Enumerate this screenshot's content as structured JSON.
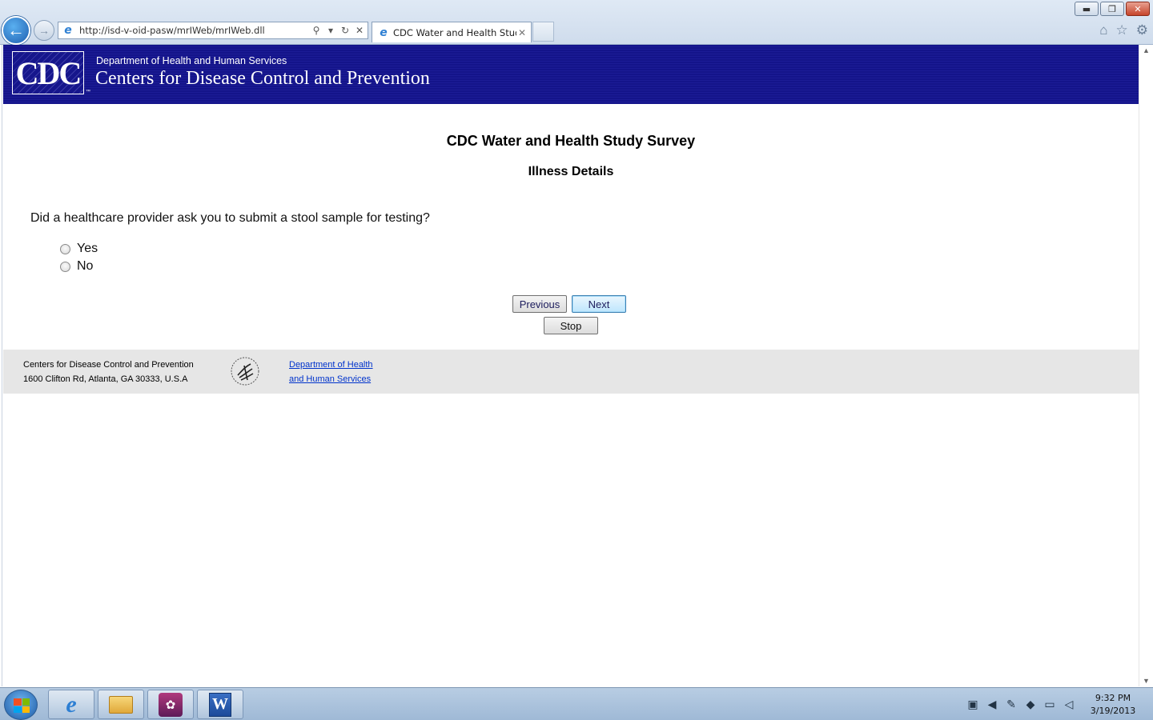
{
  "browser": {
    "url": "http://isd-v-oid-pasw/mrIWeb/mrIWeb.dll",
    "tab_title": "CDC Water and Health Study",
    "tab_close": "✕",
    "window_controls": {
      "minimize": "▬",
      "restore": "❐",
      "close": "✕"
    },
    "icons": [
      "back-icon",
      "forward-icon",
      "ie-icon",
      "search-icon",
      "refresh-icon",
      "stop-load-icon",
      "home-icon",
      "favorites-star-icon",
      "tools-gear-icon"
    ]
  },
  "banner": {
    "logo_text": "CDC",
    "logo_tm": "™",
    "department": "Department of Health and Human Services",
    "agency": "Centers for Disease Control and Prevention",
    "background_color": "#14148a"
  },
  "survey": {
    "title": "CDC Water and Health Study Survey",
    "section": "Illness Details",
    "question": "Did a healthcare provider ask you to submit a stool sample for testing?",
    "options": [
      {
        "label": "Yes",
        "selected": false
      },
      {
        "label": "No",
        "selected": false
      }
    ],
    "buttons": {
      "previous": "Previous",
      "next": "Next",
      "stop": "Stop"
    }
  },
  "footer": {
    "org": "Centers for Disease Control and Prevention",
    "address": "1600 Clifton Rd, Atlanta, GA 30333, U.S.A",
    "link_line1": "Department of Health",
    "link_line2": "and Human Services",
    "link_color": "#0033cc"
  },
  "taskbar": {
    "apps": [
      "internet-explorer",
      "windows-explorer",
      "spss-app",
      "microsoft-word"
    ],
    "time": "9:32 PM",
    "date": "3/19/2013"
  }
}
